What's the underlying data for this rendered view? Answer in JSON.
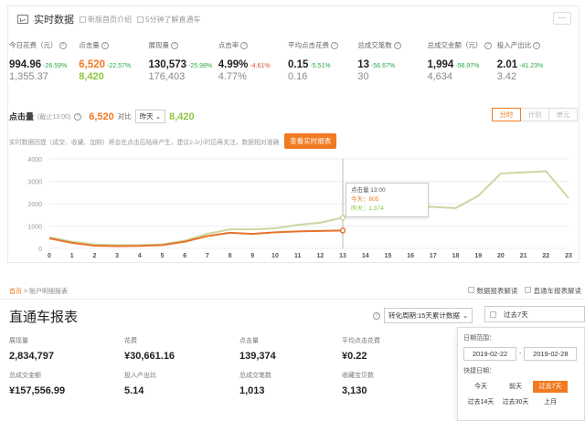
{
  "header": {
    "title": "实时数据",
    "link1": "新版首页介绍",
    "link2": "5分钟了解直通车",
    "more_label": "..."
  },
  "kpis": [
    {
      "label": "今日花费（元）",
      "value": "994.96",
      "change": "-26.59%",
      "dir": "down",
      "prev": "1,355.37"
    },
    {
      "label": "点击量",
      "value": "6,520",
      "change": "-22.57%",
      "dir": "down",
      "prev": "8,420"
    },
    {
      "label": "展现量",
      "value": "130,573",
      "change": "-25.98%",
      "dir": "down",
      "prev": "176,403"
    },
    {
      "label": "点击率",
      "value": "4.99%",
      "change": "-4.61%",
      "dir": "up",
      "prev": "4.77%"
    },
    {
      "label": "平均点击花费",
      "value": "0.15",
      "change": "-5.51%",
      "dir": "down",
      "prev": "0.16"
    },
    {
      "label": "总成交笔数",
      "value": "13",
      "change": "-56.67%",
      "dir": "down",
      "prev": "30"
    },
    {
      "label": "总成交金额（元）",
      "value": "1,994",
      "change": "-56.97%",
      "dir": "down",
      "prev": "4,634"
    },
    {
      "label": "投入产出比",
      "value": "2.01",
      "change": "-41.23%",
      "dir": "down",
      "prev": "3.42"
    }
  ],
  "click_row": {
    "label": "点击量",
    "note": "(截止13:00)",
    "today": "6,520",
    "vs": "对比",
    "compare_select": "昨天",
    "yesterday": "8,420"
  },
  "segments": [
    "分时",
    "计划",
    "单元"
  ],
  "notice": "实时数据因提（成交、收藏、加购）将会在点击后陆续产生，建议2-3小时后再关注，数据相对准确",
  "report_button": "查看实时报表",
  "tooltip": {
    "title": "点击量 13:00",
    "today": "今天：605",
    "yesterday": "昨天：1,374"
  },
  "chart_data": {
    "type": "line",
    "x": [
      0,
      1,
      2,
      3,
      4,
      5,
      6,
      7,
      8,
      9,
      10,
      11,
      12,
      13,
      14,
      15,
      16,
      17,
      18,
      19,
      20,
      21,
      22,
      23
    ],
    "yticks": [
      0,
      1000,
      2000,
      3000,
      4000
    ],
    "ylim": [
      0,
      4000
    ],
    "highlight_x": 13,
    "series": [
      {
        "values": [
          450,
          250,
          120,
          100,
          110,
          150,
          300,
          550,
          700,
          650,
          720,
          760,
          780,
          800
        ],
        "color": "#e8732a"
      },
      {
        "values": [
          500,
          300,
          180,
          150,
          150,
          180,
          350,
          650,
          850,
          850,
          900,
          1050,
          1150,
          1374,
          1900,
          2000,
          1900,
          1850,
          1800,
          2350,
          3350,
          3400,
          3450,
          2250
        ],
        "color": "#c9d8a1"
      }
    ]
  },
  "bottom": {
    "crumb_home": "首页",
    "crumb_sep": ">",
    "crumb_current": "账户明细报表",
    "link_explain": "数据报表解读",
    "link_report": "直通车报表解读",
    "page_title": "直通车报表",
    "period_label": "转化周期:15天累计数据",
    "date_value": "过去7天",
    "metrics": [
      {
        "label": "展现量",
        "value": "2,834,797"
      },
      {
        "label": "花费",
        "value": "¥30,661.16"
      },
      {
        "label": "点击量",
        "value": "139,374"
      },
      {
        "label": "平均点击花费",
        "value": "¥0.22"
      },
      {
        "label": "总成交金额",
        "value": "¥157,556.99"
      },
      {
        "label": "投入产出比",
        "value": "5.14"
      },
      {
        "label": "总成交笔数",
        "value": "1,013"
      },
      {
        "label": "收藏宝贝数",
        "value": "3,130"
      }
    ],
    "date_panel": {
      "range_label": "日期范围：",
      "start": "2019-02-22",
      "sep": "-",
      "end": "2019-02-28",
      "quick_label": "快捷日期：",
      "quick": [
        "今天",
        "前天",
        "过去7天",
        "过去14天",
        "过去30天",
        "上月"
      ]
    }
  }
}
